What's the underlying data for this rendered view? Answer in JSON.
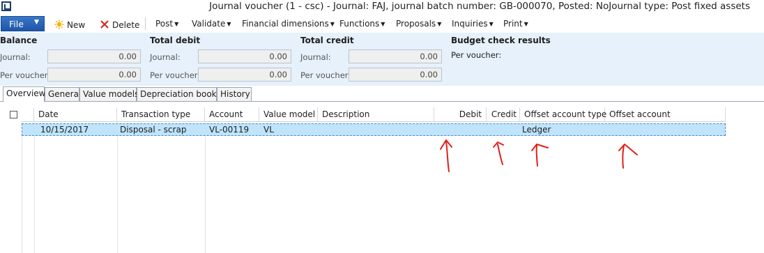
{
  "window": {
    "title": "Journal voucher (1 - csc) - Journal: FAJ, journal batch number: GB-000070, Posted: NoJournal type: Post fixed assets"
  },
  "ribbon": {
    "file_label": "File",
    "new_label": "New",
    "delete_label": "Delete",
    "menus": [
      "Post",
      "Validate",
      "Financial dimensions",
      "Functions",
      "Proposals",
      "Inquiries",
      "Print"
    ]
  },
  "totals": {
    "balance": {
      "title": "Balance",
      "journal_label": "Journal:",
      "journal_value": "0.00",
      "voucher_label": "Per voucher:",
      "voucher_value": "0.00"
    },
    "debit": {
      "title": "Total debit",
      "journal_label": "Journal:",
      "journal_value": "0.00",
      "voucher_label": "Per voucher:",
      "voucher_value": "0.00"
    },
    "credit": {
      "title": "Total credit",
      "journal_label": "Journal:",
      "journal_value": "0.00",
      "voucher_label": "Per voucher:",
      "voucher_value": "0.00"
    },
    "budget": {
      "title": "Budget check results",
      "voucher_label": "Per voucher:"
    }
  },
  "tabs": [
    "Overview",
    "General",
    "Value models",
    "Depreciation books",
    "History"
  ],
  "grid": {
    "columns": [
      "Date",
      "Transaction type",
      "Account",
      "Value model",
      "Description",
      "Debit",
      "Credit",
      "Offset account type",
      "Offset account"
    ],
    "rows": [
      {
        "date": "10/15/2017",
        "transaction_type": "Disposal - scrap",
        "account": "VL-00119",
        "value_model": "VL",
        "description": "",
        "debit": "",
        "credit": "",
        "offset_account_type": "Ledger",
        "offset_account": ""
      }
    ]
  },
  "colors": {
    "accent": "#1e56a8",
    "panel": "#e6f1fb",
    "selected_row": "#bfe4fb",
    "annotation": "#e0201a"
  }
}
